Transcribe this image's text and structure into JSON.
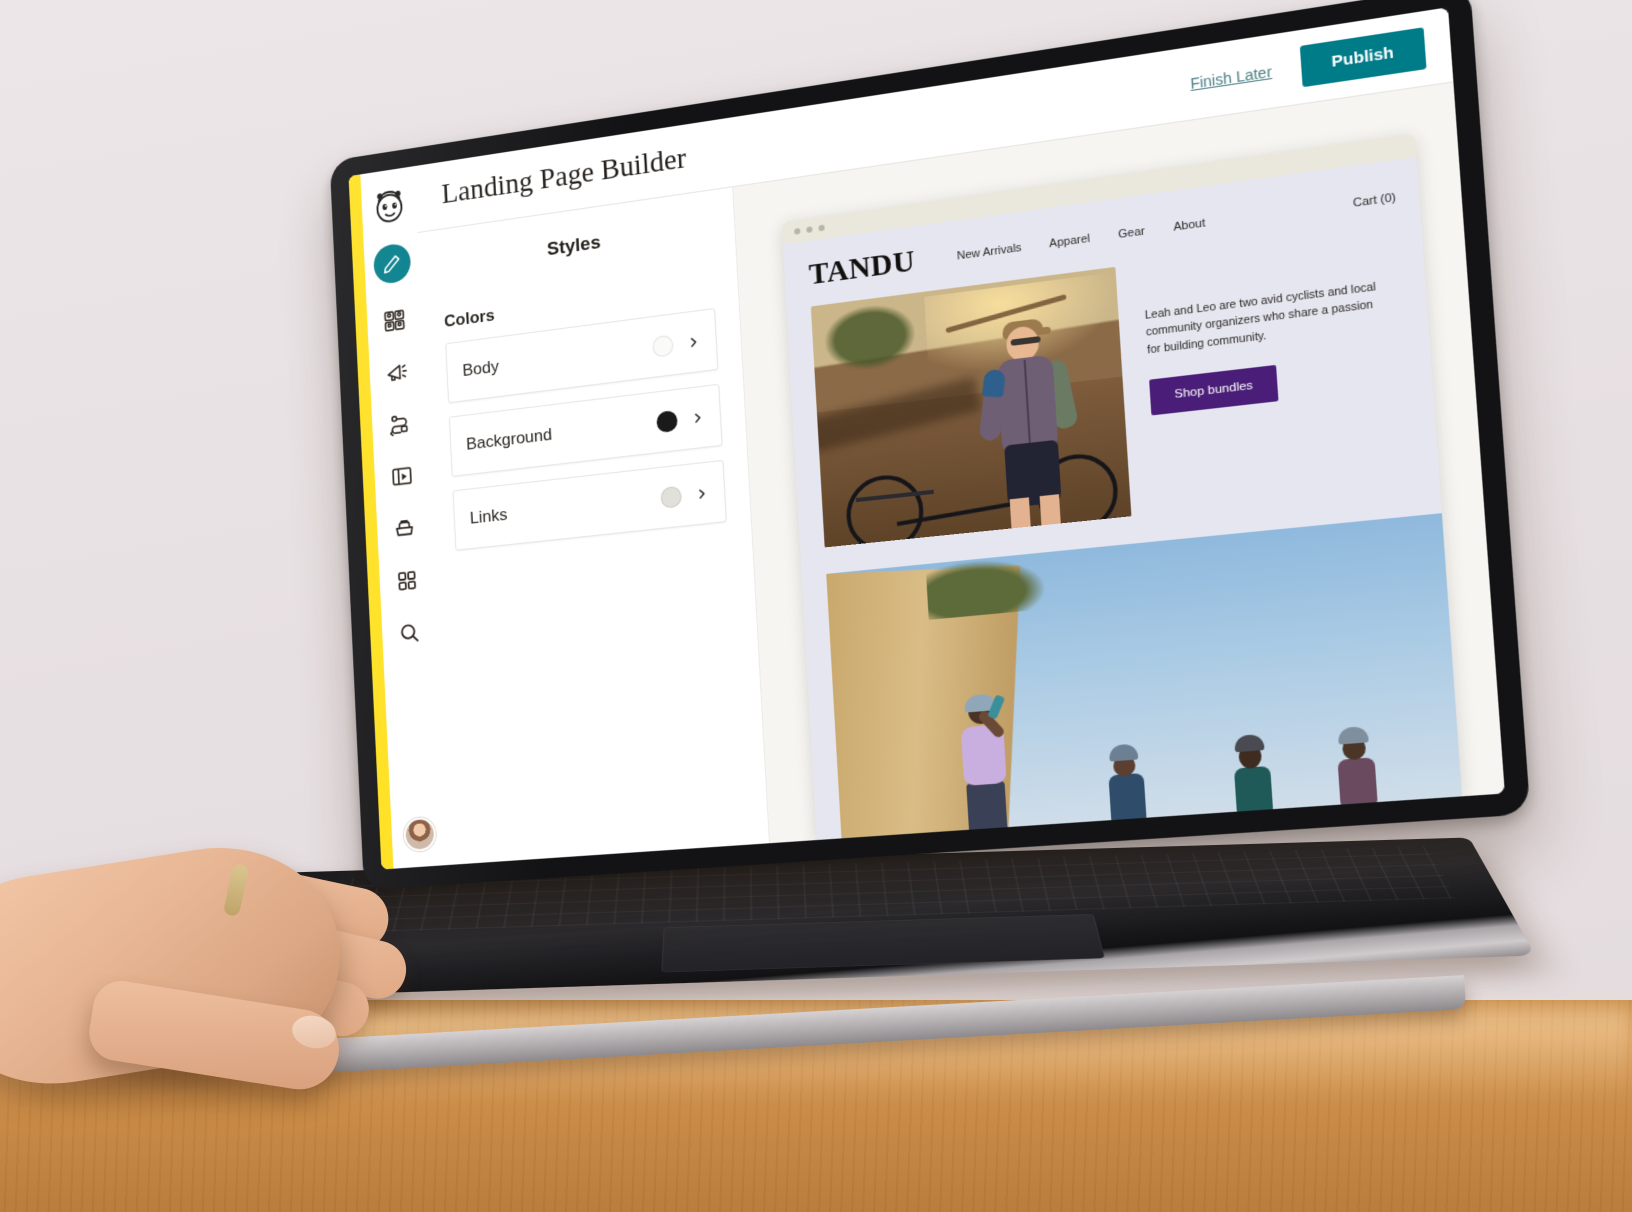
{
  "app": {
    "title": "Landing Page Builder",
    "brand_logo": "mailchimp-freddie-logo",
    "accent_yellow": "#FFE01B",
    "accent_teal": "#007C89"
  },
  "topbar": {
    "finish_later_label": "Finish Later",
    "publish_label": "Publish"
  },
  "rail": {
    "items": [
      {
        "icon": "pencil-create-icon",
        "active": true
      },
      {
        "icon": "audience-contacts-icon",
        "active": false
      },
      {
        "icon": "megaphone-campaigns-icon",
        "active": false
      },
      {
        "icon": "automations-icon",
        "active": false
      },
      {
        "icon": "content-landing-page-icon",
        "active": false
      },
      {
        "icon": "store-commerce-icon",
        "active": false
      },
      {
        "icon": "apps-grid-icon",
        "active": false
      },
      {
        "icon": "search-icon",
        "active": false
      }
    ],
    "avatar": "user-avatar"
  },
  "styles_panel": {
    "title": "Styles",
    "colors_label": "Colors",
    "rows": [
      {
        "label": "Body",
        "swatch": "#FAFAF8",
        "chevron": "chevron-right-icon"
      },
      {
        "label": "Background",
        "swatch": "#1A1A1A",
        "chevron": "chevron-right-icon"
      },
      {
        "label": "Links",
        "swatch": "#E2E0DA",
        "chevron": "chevron-right-icon"
      }
    ]
  },
  "preview": {
    "browser_dots": 3,
    "site": {
      "brand": "TANDU",
      "nav": [
        "New Arrivals",
        "Apparel",
        "Gear",
        "About"
      ],
      "cart": "Cart (0)",
      "hero": {
        "image_alt": "cyclist-standing-with-bike-on-dirt-trail",
        "paragraph": "Leah and Leo are two avid cyclists and local community organizers who share a passion for building community.",
        "cta_label": "Shop bundles",
        "cta_color": "#4A1D78",
        "background": "#E6E6F1"
      },
      "band": {
        "image_alt": "group-of-cyclists-on-sandy-cliff-against-blue-sky"
      }
    }
  },
  "scene": {
    "device": "laptop-on-wooden-desk",
    "hand": "hand-on-trackpad"
  }
}
